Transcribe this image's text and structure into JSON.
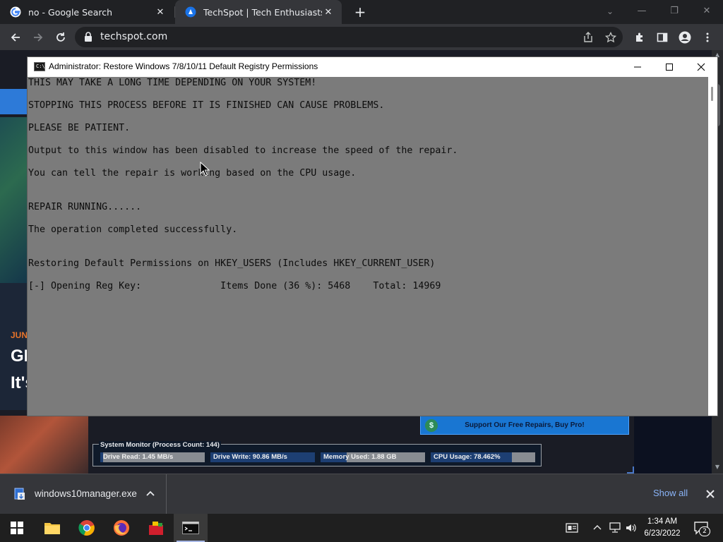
{
  "browser": {
    "tabs": [
      {
        "title": "no - Google Search",
        "icon": "google-icon",
        "active": false
      },
      {
        "title": "TechSpot | Tech Enthusiasts, Power Users",
        "icon": "techspot-icon",
        "active": true
      }
    ],
    "url": "techspot.com"
  },
  "page": {
    "date_fragment": "JUN",
    "headline_line1": "GI",
    "headline_line2": "It's",
    "support_button": "Support Our Free Repairs, Buy Pro!",
    "system_monitor": {
      "title": "System Monitor (Process Count: 144)",
      "meters": [
        {
          "label": "Drive Read: 1.45 MB/s",
          "level": 0.03
        },
        {
          "label": "Drive Write: 90.86 MB/s",
          "level": 1.0
        },
        {
          "label": "Memory Used: 1.88 GB",
          "level": 0.25
        },
        {
          "label": "CPU Usage: 78.462%",
          "level": 0.78
        }
      ]
    }
  },
  "console": {
    "title": "Administrator:  Restore Windows 7/8/10/11 Default Registry Permissions",
    "lines": [
      "THIS MAY TAKE A LONG TIME DEPENDING ON YOUR SYSTEM!",
      "STOPPING THIS PROCESS BEFORE IT IS FINISHED CAN CAUSE PROBLEMS.",
      "PLEASE BE PATIENT.",
      "Output to this window has been disabled to increase the speed of the repair.",
      "You can tell the repair is working based on the CPU usage.",
      "REPAIR RUNNING......",
      "The operation completed successfully.",
      "Restoring Default Permissions on HKEY_USERS (Includes HKEY_CURRENT_USER)",
      "[-] Opening Reg Key:              Items Done (36 %): 5468    Total: 14969"
    ]
  },
  "downloads": {
    "file": "windows10manager.exe",
    "show_all": "Show all"
  },
  "taskbar": {
    "time": "1:34 AM",
    "date": "6/23/2022",
    "notification_count": "2"
  }
}
